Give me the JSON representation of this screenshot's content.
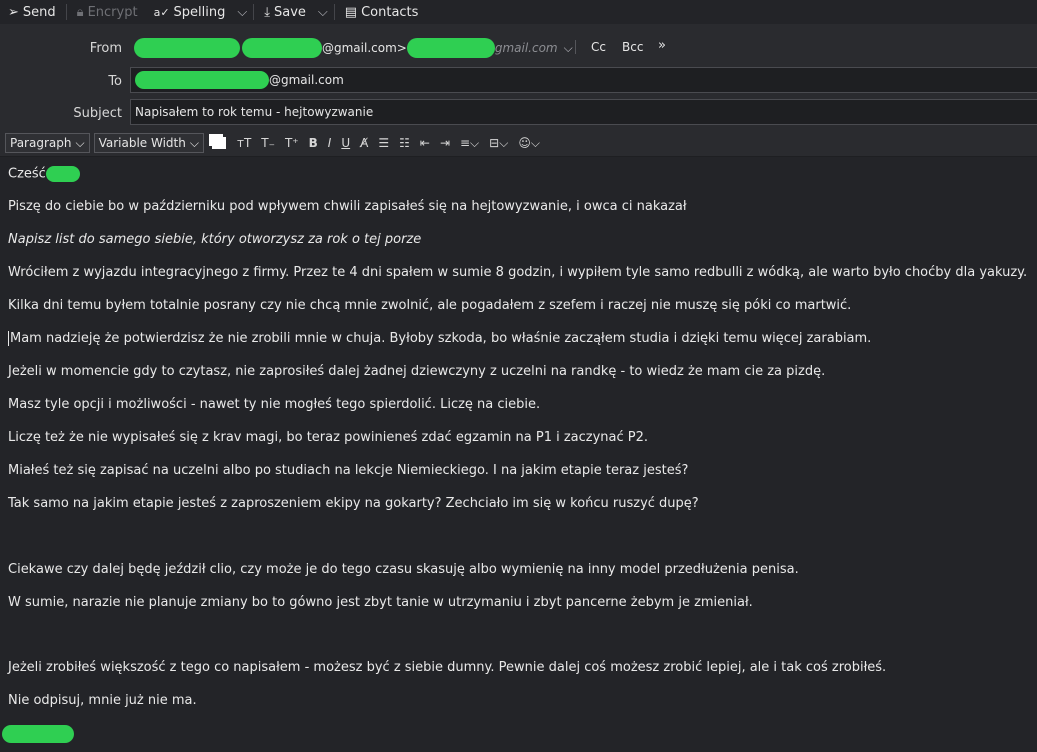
{
  "toolbar": {
    "send": "Send",
    "encrypt": "Encrypt",
    "spelling": "Spelling",
    "save": "Save",
    "contacts": "Contacts"
  },
  "header": {
    "from_label": "From",
    "from_domain": "@gmail.com>",
    "from_domain2": "gmail.com",
    "cc": "Cc",
    "bcc": "Bcc",
    "to_label": "To",
    "to_domain": "@gmail.com",
    "subject_label": "Subject",
    "subject_value": "Napisałem to rok temu - hejtowyzwanie"
  },
  "format": {
    "paragraph": "Paragraph",
    "width": "Variable Width"
  },
  "body_lines": [
    "Cześć",
    "Piszę do ciebie bo w październiku pod wpływem chwili zapisałeś się na hejtowyzwanie, i owca ci nakazał",
    "Napisz list do samego siebie, który otworzysz za rok o tej porze",
    "Wróciłem z wyjazdu integracyjnego z firmy. Przez te 4 dni spałem w sumie 8 godzin, i wypiłem tyle samo redbulli z wódką, ale warto było choćby dla yakuzy.",
    "Kilka dni temu byłem totalnie posrany czy nie chcą mnie zwolnić, ale pogadałem z szefem i raczej nie muszę się póki co martwić.",
    "Mam nadzieję że potwierdzisz że nie zrobili mnie w chuja. Byłoby szkoda, bo właśnie zacząłem studia i dzięki temu więcej zarabiam.",
    "Jeżeli w momencie gdy to czytasz, nie zaprosiłeś dalej żadnej dziewczyny z uczelni na randkę - to wiedz że mam cie za pizdę.",
    "Masz tyle opcji i możliwości - nawet ty nie mogłeś tego spierdolić. Liczę na ciebie.",
    "Liczę też że nie wypisałeś się z krav magi, bo teraz powinieneś zdać egzamin na P1 i zaczynać P2.",
    "Miałeś też się zapisać na uczelni albo po studiach na lekcje Niemieckiego. I na jakim etapie teraz jesteś?",
    "Tak samo na jakim etapie jesteś z zaproszeniem ekipy na gokarty? Zechciało im się w końcu ruszyć dupę?",
    "Ciekawe czy dalej będę jeździł clio, czy może je do tego czasu skasuję albo wymienię na inny model przedłużenia penisa.",
    "W sumie, narazie nie planuje zmiany bo to gówno jest zbyt tanie w utrzymaniu i zbyt pancerne żebym je zmieniał.",
    "Jeżeli zrobiłeś większość z tego co napisałem - możesz być z siebie dumny. Pewnie dalej coś możesz zrobić lepiej, ale i tak coś zrobiłeś.",
    "Nie odpisuj, mnie już nie ma."
  ]
}
